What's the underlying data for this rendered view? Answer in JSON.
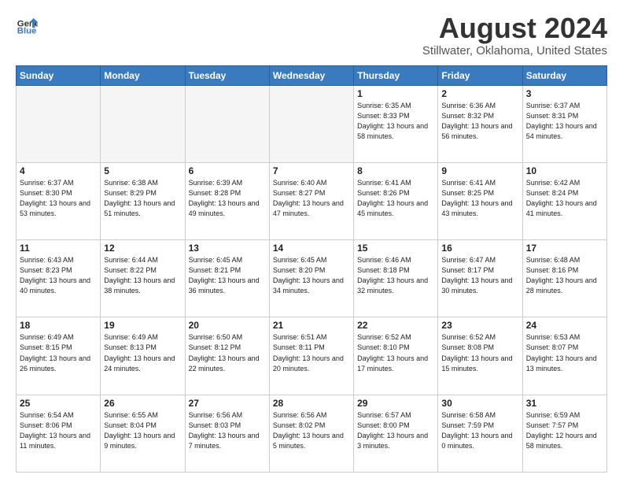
{
  "logo": {
    "line1": "General",
    "line2": "Blue"
  },
  "title": "August 2024",
  "subtitle": "Stillwater, Oklahoma, United States",
  "days_header": [
    "Sunday",
    "Monday",
    "Tuesday",
    "Wednesday",
    "Thursday",
    "Friday",
    "Saturday"
  ],
  "weeks": [
    [
      {
        "num": "",
        "empty": true
      },
      {
        "num": "",
        "empty": true
      },
      {
        "num": "",
        "empty": true
      },
      {
        "num": "",
        "empty": true
      },
      {
        "num": "1",
        "sunrise": "6:35 AM",
        "sunset": "8:33 PM",
        "daylight": "13 hours and 58 minutes."
      },
      {
        "num": "2",
        "sunrise": "6:36 AM",
        "sunset": "8:32 PM",
        "daylight": "13 hours and 56 minutes."
      },
      {
        "num": "3",
        "sunrise": "6:37 AM",
        "sunset": "8:31 PM",
        "daylight": "13 hours and 54 minutes."
      }
    ],
    [
      {
        "num": "4",
        "sunrise": "6:37 AM",
        "sunset": "8:30 PM",
        "daylight": "13 hours and 53 minutes."
      },
      {
        "num": "5",
        "sunrise": "6:38 AM",
        "sunset": "8:29 PM",
        "daylight": "13 hours and 51 minutes."
      },
      {
        "num": "6",
        "sunrise": "6:39 AM",
        "sunset": "8:28 PM",
        "daylight": "13 hours and 49 minutes."
      },
      {
        "num": "7",
        "sunrise": "6:40 AM",
        "sunset": "8:27 PM",
        "daylight": "13 hours and 47 minutes."
      },
      {
        "num": "8",
        "sunrise": "6:41 AM",
        "sunset": "8:26 PM",
        "daylight": "13 hours and 45 minutes."
      },
      {
        "num": "9",
        "sunrise": "6:41 AM",
        "sunset": "8:25 PM",
        "daylight": "13 hours and 43 minutes."
      },
      {
        "num": "10",
        "sunrise": "6:42 AM",
        "sunset": "8:24 PM",
        "daylight": "13 hours and 41 minutes."
      }
    ],
    [
      {
        "num": "11",
        "sunrise": "6:43 AM",
        "sunset": "8:23 PM",
        "daylight": "13 hours and 40 minutes."
      },
      {
        "num": "12",
        "sunrise": "6:44 AM",
        "sunset": "8:22 PM",
        "daylight": "13 hours and 38 minutes."
      },
      {
        "num": "13",
        "sunrise": "6:45 AM",
        "sunset": "8:21 PM",
        "daylight": "13 hours and 36 minutes."
      },
      {
        "num": "14",
        "sunrise": "6:45 AM",
        "sunset": "8:20 PM",
        "daylight": "13 hours and 34 minutes."
      },
      {
        "num": "15",
        "sunrise": "6:46 AM",
        "sunset": "8:18 PM",
        "daylight": "13 hours and 32 minutes."
      },
      {
        "num": "16",
        "sunrise": "6:47 AM",
        "sunset": "8:17 PM",
        "daylight": "13 hours and 30 minutes."
      },
      {
        "num": "17",
        "sunrise": "6:48 AM",
        "sunset": "8:16 PM",
        "daylight": "13 hours and 28 minutes."
      }
    ],
    [
      {
        "num": "18",
        "sunrise": "6:49 AM",
        "sunset": "8:15 PM",
        "daylight": "13 hours and 26 minutes."
      },
      {
        "num": "19",
        "sunrise": "6:49 AM",
        "sunset": "8:13 PM",
        "daylight": "13 hours and 24 minutes."
      },
      {
        "num": "20",
        "sunrise": "6:50 AM",
        "sunset": "8:12 PM",
        "daylight": "13 hours and 22 minutes."
      },
      {
        "num": "21",
        "sunrise": "6:51 AM",
        "sunset": "8:11 PM",
        "daylight": "13 hours and 20 minutes."
      },
      {
        "num": "22",
        "sunrise": "6:52 AM",
        "sunset": "8:10 PM",
        "daylight": "13 hours and 17 minutes."
      },
      {
        "num": "23",
        "sunrise": "6:52 AM",
        "sunset": "8:08 PM",
        "daylight": "13 hours and 15 minutes."
      },
      {
        "num": "24",
        "sunrise": "6:53 AM",
        "sunset": "8:07 PM",
        "daylight": "13 hours and 13 minutes."
      }
    ],
    [
      {
        "num": "25",
        "sunrise": "6:54 AM",
        "sunset": "8:06 PM",
        "daylight": "13 hours and 11 minutes."
      },
      {
        "num": "26",
        "sunrise": "6:55 AM",
        "sunset": "8:04 PM",
        "daylight": "13 hours and 9 minutes."
      },
      {
        "num": "27",
        "sunrise": "6:56 AM",
        "sunset": "8:03 PM",
        "daylight": "13 hours and 7 minutes."
      },
      {
        "num": "28",
        "sunrise": "6:56 AM",
        "sunset": "8:02 PM",
        "daylight": "13 hours and 5 minutes."
      },
      {
        "num": "29",
        "sunrise": "6:57 AM",
        "sunset": "8:00 PM",
        "daylight": "13 hours and 3 minutes."
      },
      {
        "num": "30",
        "sunrise": "6:58 AM",
        "sunset": "7:59 PM",
        "daylight": "13 hours and 0 minutes."
      },
      {
        "num": "31",
        "sunrise": "6:59 AM",
        "sunset": "7:57 PM",
        "daylight": "12 hours and 58 minutes."
      }
    ]
  ]
}
